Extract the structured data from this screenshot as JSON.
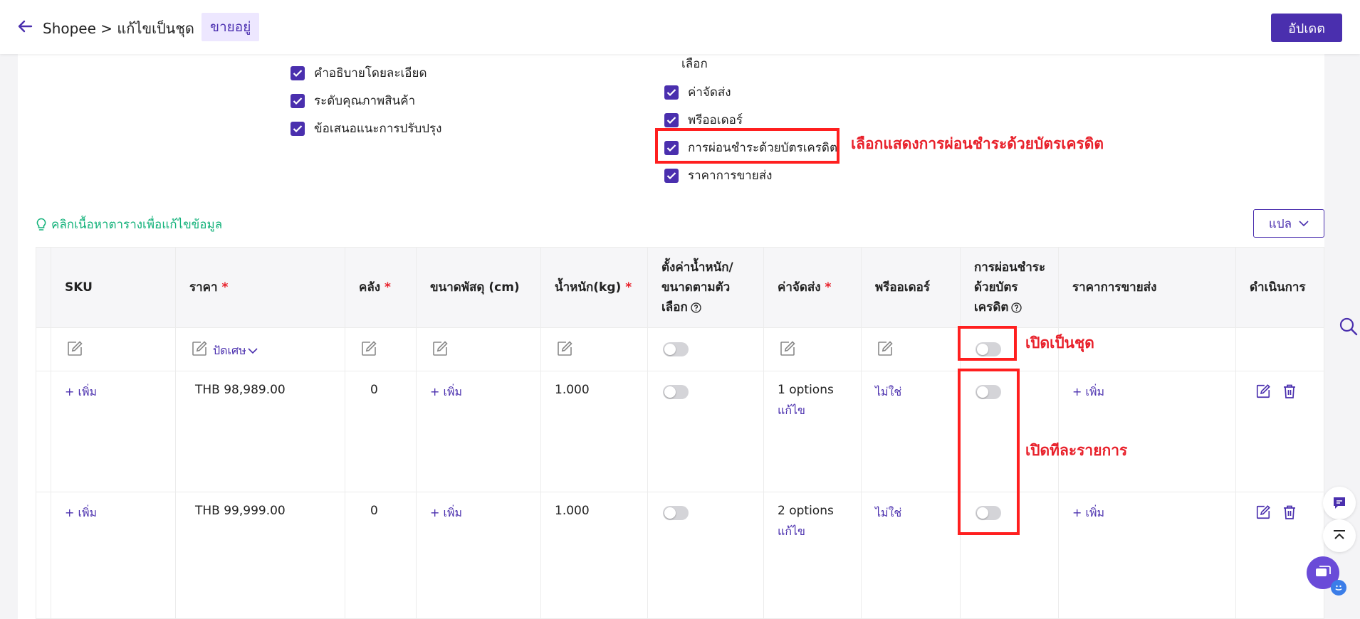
{
  "header": {
    "breadcrumb": "Shopee > แก้ไขเป็นชุด",
    "status_badge": "ขายอยู่",
    "update_button": "อัปเดต"
  },
  "left_checkboxes": [
    {
      "label": "คำอธิบายโดยละเอียด",
      "checked": true
    },
    {
      "label": "ระดับคุณภาพสินค้า",
      "checked": true
    },
    {
      "label": "ข้อเสนอแนะการปรับปรุง",
      "checked": true
    }
  ],
  "optional_section": {
    "header": "เลือก",
    "items": [
      {
        "label": "ค่าจัดส่ง",
        "checked": true
      },
      {
        "label": "พรีออเดอร์",
        "checked": true
      },
      {
        "label": "การผ่อนชำระด้วยบัตรเครดิต",
        "checked": true
      },
      {
        "label": "ราคาการขายส่ง",
        "checked": true
      }
    ]
  },
  "annotations": {
    "installment_select": "เลือกแสดงการผ่อนชำระด้วยบัตรเครดิต",
    "batch_open": "เปิดเป็นชุด",
    "per_item_open": "เปิดทีละรายการ"
  },
  "hint_text": "คลิกเนื้อหาตารางเพื่อแก้ไขข้อมูล",
  "translate_button": "แปล",
  "table": {
    "headers": {
      "sku": "SKU",
      "price": "ราคา",
      "stock": "คลัง",
      "package_size": "ขนาดพัสดุ (cm)",
      "weight": "น้ำหนัก(kg)",
      "variant_weight_1": "ตั้งค่าน้ำหนัก/",
      "variant_weight_2": "ขนาดตามตัว",
      "variant_weight_3": "เลือก",
      "shipping": "ค่าจัดส่ง",
      "preorder": "พรีออเดอร์",
      "installment_1": "การผ่อนชำระ",
      "installment_2": "ด้วยบัตร",
      "installment_3": "เครดิต",
      "wholesale": "ราคาการขายส่ง",
      "actions": "ดำเนินการ"
    },
    "required_mark": "*",
    "batch_row": {
      "rounding_label": "ปัดเศษ"
    },
    "rows": [
      {
        "sku": "+ เพิ่ม",
        "price": "THB 98,989.00",
        "stock": "0",
        "package_size": "+ เพิ่ม",
        "weight": "1.000",
        "variant_weight_on": false,
        "shipping": "1 options",
        "shipping_edit": "แก้ไข",
        "preorder": "ไม่ใช่",
        "installment_on": false,
        "wholesale": "+ เพิ่ม"
      },
      {
        "sku": "+ เพิ่ม",
        "price": "THB 99,999.00",
        "stock": "0",
        "package_size": "+ เพิ่ม",
        "weight": "1.000",
        "variant_weight_on": false,
        "shipping": "2 options",
        "shipping_edit": "แก้ไข",
        "preorder": "ไม่ใช่",
        "installment_on": false,
        "wholesale": "+ เพิ่ม"
      }
    ]
  },
  "colors": {
    "accent": "#4a2fae",
    "annotation_red": "#ff1f1f",
    "hint_green": "#13b27a"
  }
}
